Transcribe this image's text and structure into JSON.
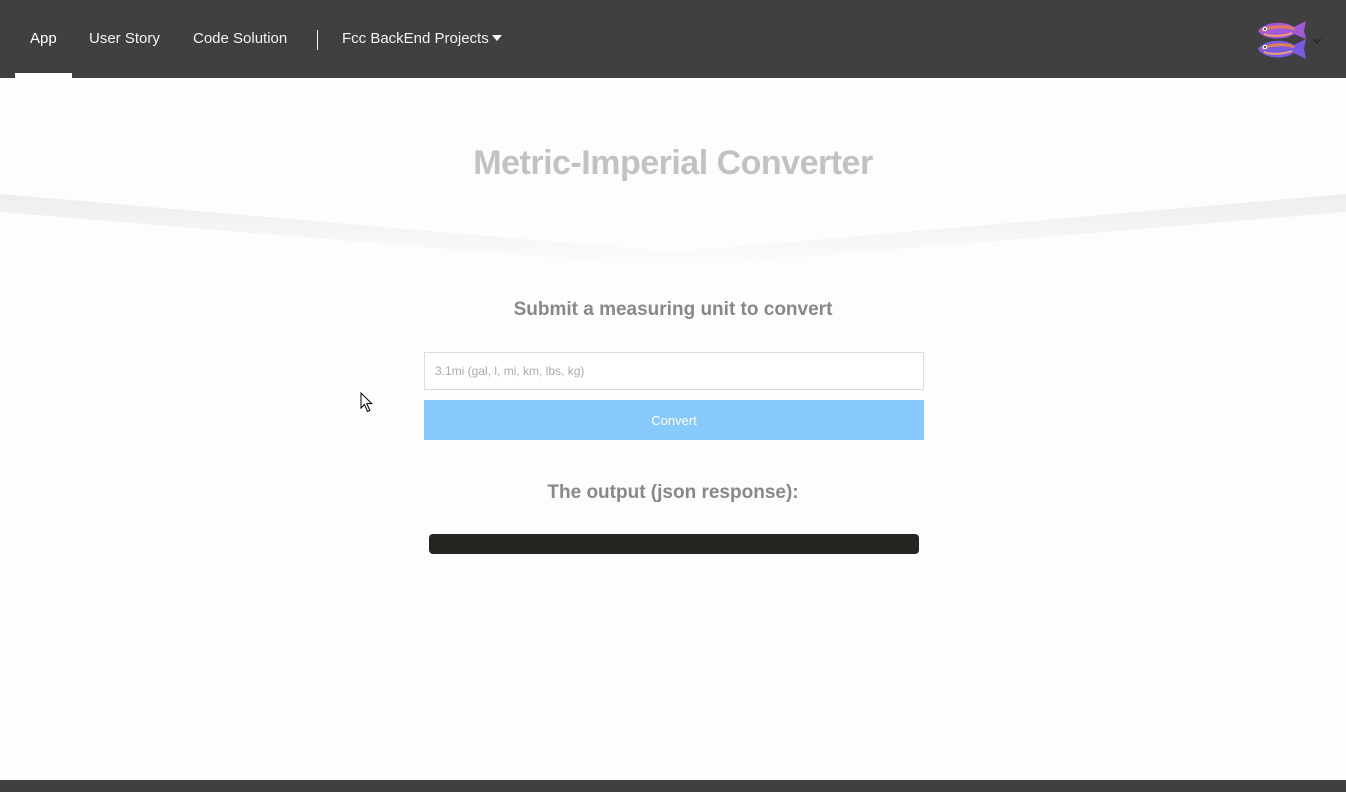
{
  "nav": {
    "items": [
      {
        "label": "App",
        "active": true
      },
      {
        "label": "User Story",
        "active": false
      },
      {
        "label": "Code Solution",
        "active": false
      }
    ],
    "projects_label": "Fcc BackEnd Projects",
    "avatar_icon": "fish-avatar-icon",
    "menu_icon": "chevron-down-icon"
  },
  "hero": {
    "title": "Metric-Imperial Converter"
  },
  "form": {
    "heading": "Submit a measuring unit to convert",
    "input_value": "",
    "input_placeholder": "3.1mi (gal, l, mi, km, lbs, kg)",
    "button_label": "Convert"
  },
  "output": {
    "heading": "The output (json response):",
    "value": ""
  },
  "colors": {
    "navbar": "#404040",
    "button": "#87c9fb",
    "title": "#c2c2c2",
    "heading": "#888888",
    "output_bg": "#242520"
  }
}
